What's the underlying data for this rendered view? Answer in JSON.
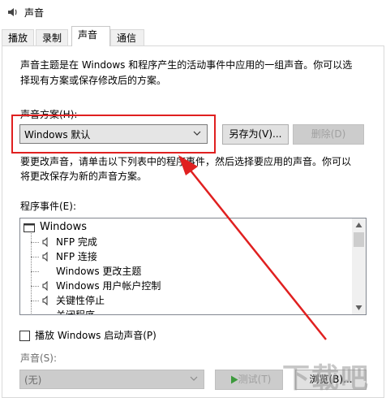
{
  "window": {
    "title": "声音"
  },
  "tabs": [
    {
      "label": "播放"
    },
    {
      "label": "录制"
    },
    {
      "label": "声音"
    },
    {
      "label": "通信"
    }
  ],
  "description": {
    "line1": "声音主题是在 Windows 和程序产生的活动事件中应用的一组声音。你可以选",
    "line2": "择现有方案或保存修改后的方案。"
  },
  "scheme": {
    "label": "声音方案(H):",
    "selected": "Windows 默认",
    "save_as": "另存为(V)...",
    "delete": "删除(D)"
  },
  "instruction": {
    "line1": "要更改声音，请单击以下列表中的程序事件，然后选择要应用的声音。你可以",
    "line2": "将更改保存为新的声音方案。"
  },
  "events": {
    "label": "程序事件(E):",
    "items": [
      {
        "text": "Windows"
      },
      {
        "text": "NFP 完成"
      },
      {
        "text": "NFP 连接"
      },
      {
        "text": "Windows 更改主题"
      },
      {
        "text": "Windows 用户帐户控制"
      },
      {
        "text": "关键性停止"
      },
      {
        "text": "关闭程序"
      }
    ]
  },
  "startup_sound": {
    "label": "播放 Windows 启动声音(P)"
  },
  "sound": {
    "label": "声音(S):",
    "selected": "(无)",
    "test": "测试(T)",
    "browse": "浏览(B)..."
  },
  "watermark": {
    "text": "下载吧"
  },
  "colors": {
    "accent_red": "#e02020"
  }
}
